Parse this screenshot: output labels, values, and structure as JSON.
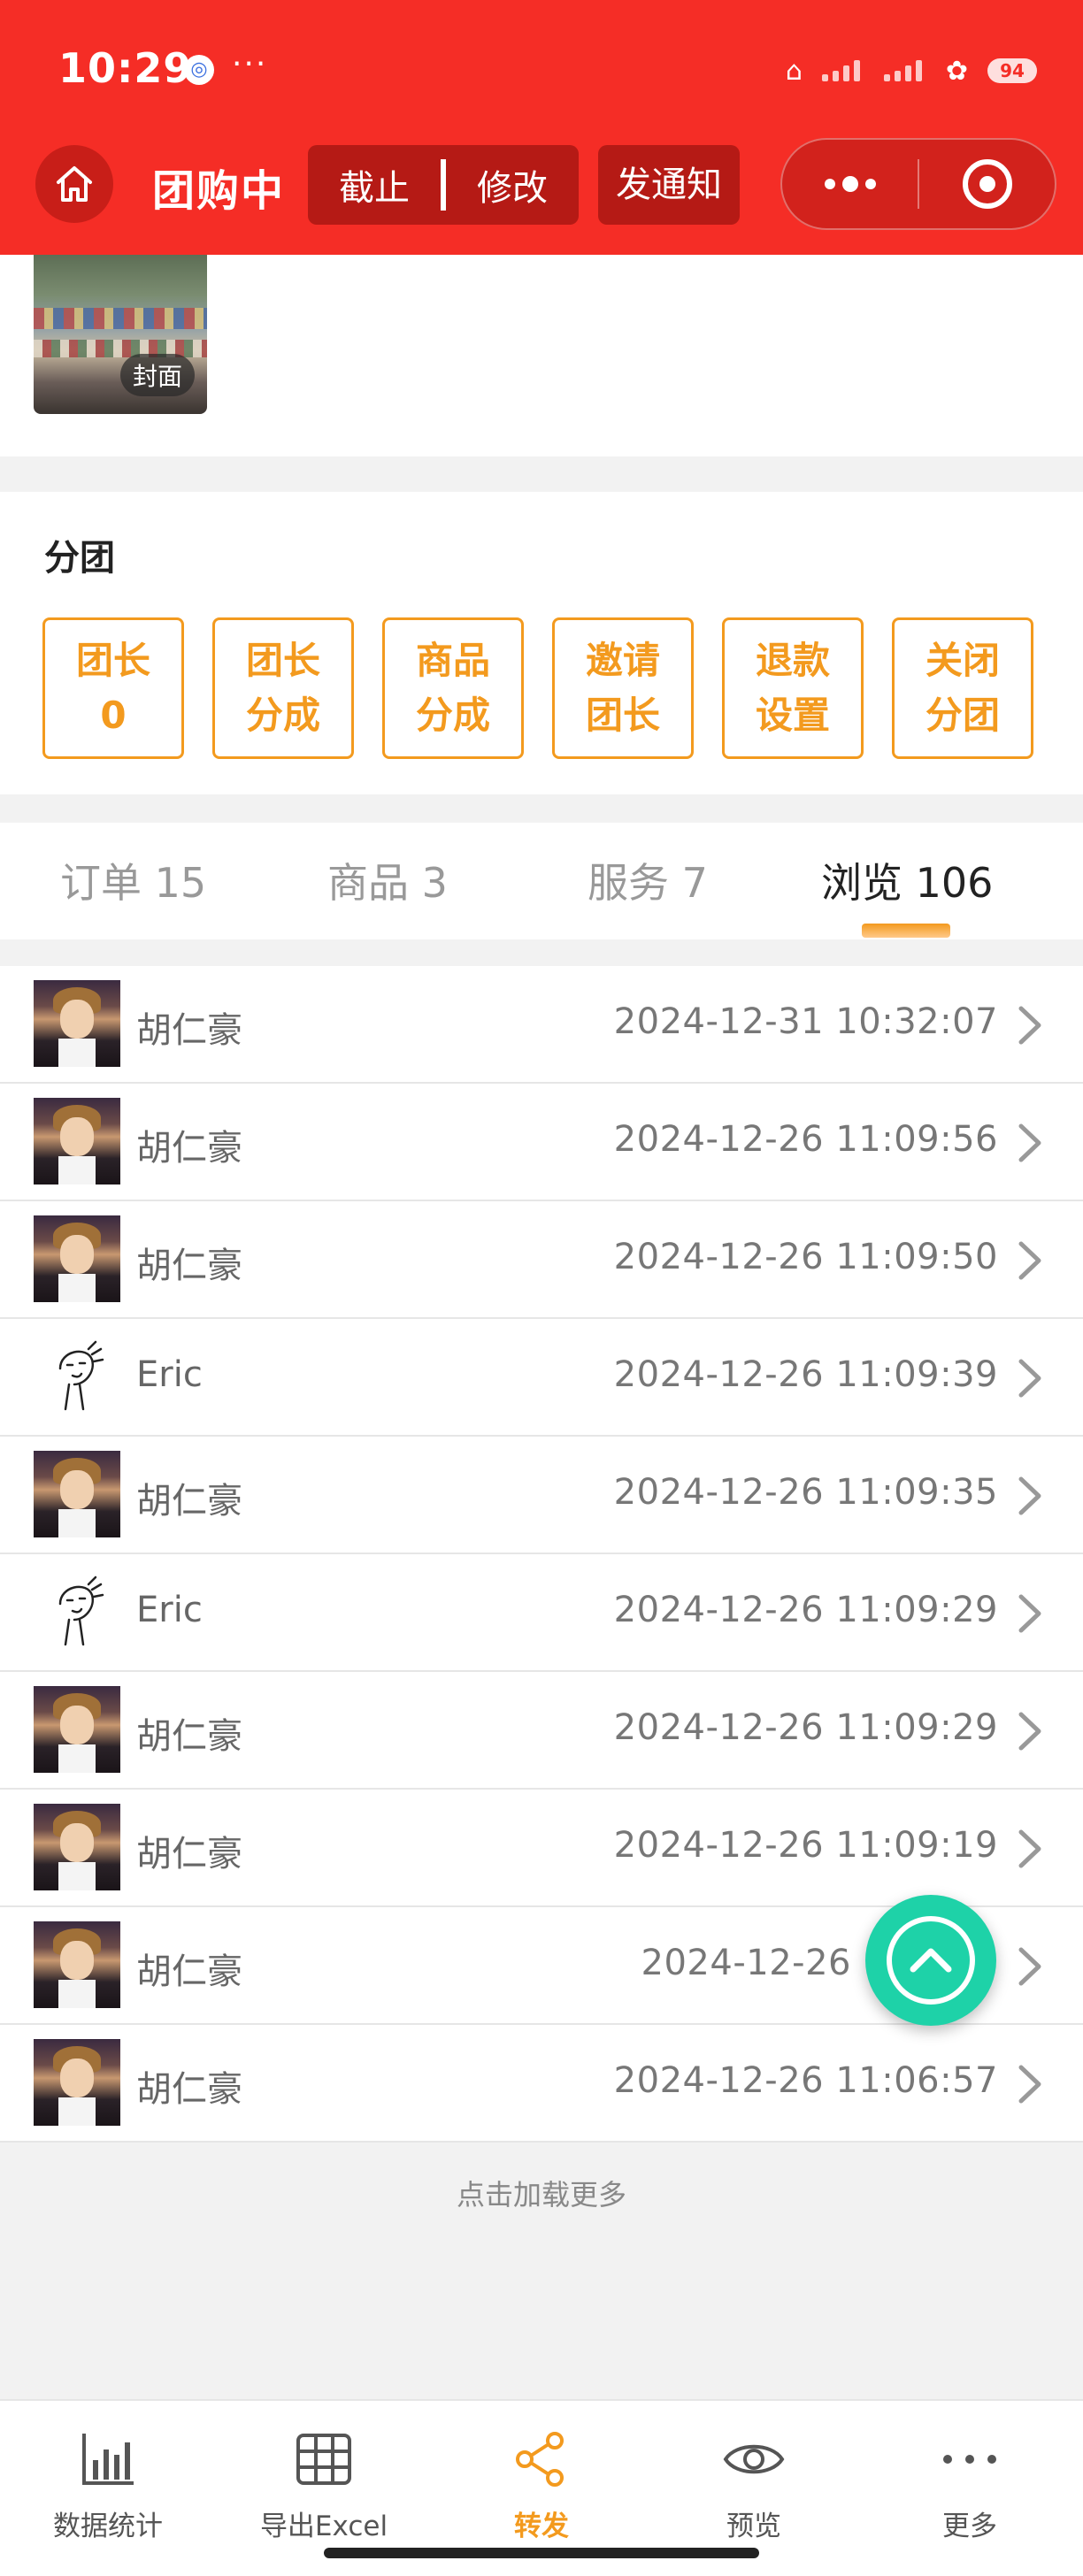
{
  "status_bar": {
    "time": "10:29",
    "more": "···",
    "battery": "94"
  },
  "nav": {
    "title": "团购中",
    "stop_label": "截止",
    "edit_label": "修改",
    "notify_label": "发通知"
  },
  "cover": {
    "label": "封面"
  },
  "subgroup": {
    "title": "分团",
    "buttons": [
      {
        "line1": "团长",
        "line2": "0"
      },
      {
        "line1": "团长",
        "line2": "分成"
      },
      {
        "line1": "商品",
        "line2": "分成"
      },
      {
        "line1": "邀请",
        "line2": "团长"
      },
      {
        "line1": "退款",
        "line2": "设置"
      },
      {
        "line1": "关闭",
        "line2": "分团"
      }
    ]
  },
  "tabs": [
    {
      "label": "订单 15",
      "active": false
    },
    {
      "label": "商品 3",
      "active": false
    },
    {
      "label": "服务 7",
      "active": false
    },
    {
      "label": "浏览 106",
      "active": true
    }
  ],
  "views": [
    {
      "name": "胡仁豪",
      "time": "2024-12-31 10:32:07",
      "avatar": "anime"
    },
    {
      "name": "胡仁豪",
      "time": "2024-12-26 11:09:56",
      "avatar": "anime"
    },
    {
      "name": "胡仁豪",
      "time": "2024-12-26 11:09:50",
      "avatar": "anime"
    },
    {
      "name": "Eric",
      "time": "2024-12-26 11:09:39",
      "avatar": "sketch"
    },
    {
      "name": "胡仁豪",
      "time": "2024-12-26 11:09:35",
      "avatar": "anime"
    },
    {
      "name": "Eric",
      "time": "2024-12-26 11:09:29",
      "avatar": "sketch"
    },
    {
      "name": "胡仁豪",
      "time": "2024-12-26 11:09:29",
      "avatar": "anime"
    },
    {
      "name": "胡仁豪",
      "time": "2024-12-26 11:09:19",
      "avatar": "anime"
    },
    {
      "name": "胡仁豪",
      "time": "2024-12-26",
      "avatar": "anime"
    },
    {
      "name": "胡仁豪",
      "time": "2024-12-26 11:06:57",
      "avatar": "anime"
    }
  ],
  "load_more": "点击加载更多",
  "bottom_bar": [
    {
      "label": "数据统计",
      "icon": "bar-chart-icon",
      "active": false
    },
    {
      "label": "导出Excel",
      "icon": "table-icon",
      "active": false
    },
    {
      "label": "转发",
      "icon": "share-icon",
      "active": true
    },
    {
      "label": "预览",
      "icon": "eye-icon",
      "active": false
    },
    {
      "label": "更多",
      "icon": "more-dots-icon",
      "active": false
    }
  ],
  "colors": {
    "header_red": "#f52d26",
    "accent_orange": "#f39a1e",
    "scroll_top_green": "#1ed2a8"
  }
}
